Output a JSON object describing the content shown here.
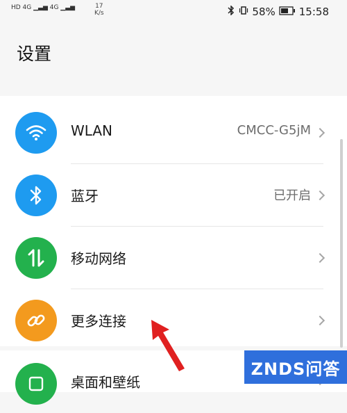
{
  "status_bar": {
    "left_signal": "HD 4G ▁▃▅ 4G ▁▃▅",
    "speed_value": "17",
    "speed_unit": "K/s",
    "battery_percent": "58%",
    "time": "15:58"
  },
  "page": {
    "title": "设置"
  },
  "settings": {
    "items": [
      {
        "label": "WLAN",
        "value": "CMCC-G5jM",
        "icon": "wifi-icon",
        "color": "#1e9bf0"
      },
      {
        "label": "蓝牙",
        "value": "已开启",
        "icon": "bluetooth-icon",
        "color": "#1e9bf0"
      },
      {
        "label": "移动网络",
        "value": "",
        "icon": "mobile-data-icon",
        "color": "#23b14d"
      },
      {
        "label": "更多连接",
        "value": "",
        "icon": "link-icon",
        "color": "#f39a1e"
      }
    ],
    "partial_item": {
      "label": "桌面和壁纸",
      "icon": "wallpaper-icon",
      "color": "#23b14d"
    }
  },
  "watermark": {
    "text": "ZNDS问答"
  },
  "colors": {
    "arrow": "#e02020"
  }
}
